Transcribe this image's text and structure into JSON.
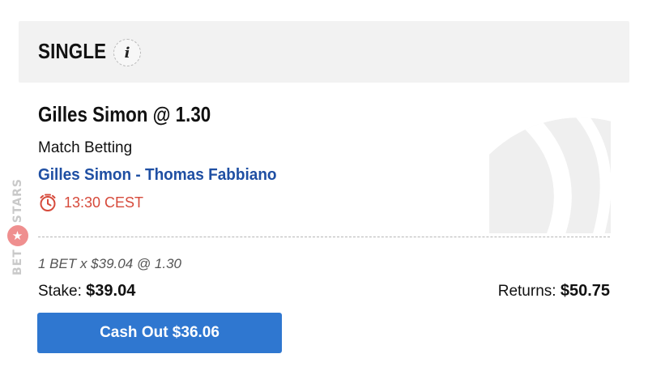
{
  "brand": {
    "left_text": "BET",
    "right_text": "STARS",
    "star_glyph": "★",
    "icon": "betstars-logo-icon"
  },
  "header": {
    "title": "SINGLE",
    "info_glyph": "i",
    "info_icon": "info-icon"
  },
  "selection": {
    "title": "Gilles Simon @ 1.30",
    "market": "Match Betting",
    "event": "Gilles Simon - Thomas Fabbiano",
    "time": "13:30 CEST",
    "time_icon": "clock-icon",
    "sport_icon": "tennis-ball-icon"
  },
  "bet": {
    "summary": "1 BET x $39.04 @ 1.30",
    "stake_label": "Stake:",
    "stake_value": "$39.04",
    "returns_label": "Returns:",
    "returns_value": "$50.75"
  },
  "cashout": {
    "label": "Cash Out $36.06"
  },
  "colors": {
    "accent_blue": "#2f77d0",
    "link_blue": "#1f4fa3",
    "time_red": "#d64a3b",
    "header_bg": "#f2f2f2"
  }
}
